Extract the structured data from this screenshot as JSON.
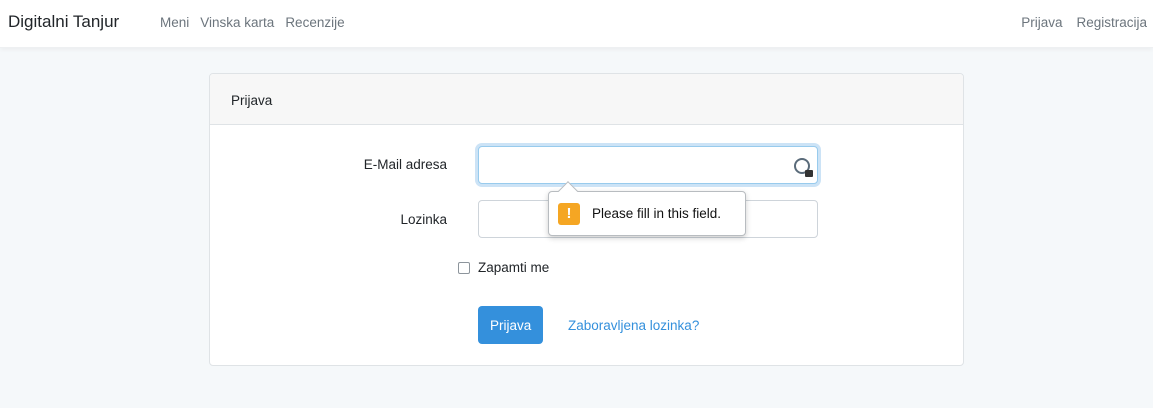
{
  "navbar": {
    "brand": "Digitalni Tanjur",
    "left_links": [
      "Meni",
      "Vinska karta",
      "Recenzije"
    ],
    "right_links": [
      "Prijava",
      "Registracija"
    ]
  },
  "login_card": {
    "header": "Prijava",
    "email_label": "E-Mail adresa",
    "email_value": "",
    "password_label": "Lozinka",
    "password_value": "",
    "remember_label": "Zapamti me",
    "remember_checked": false,
    "submit_label": "Prijava",
    "forgot_label": "Zaboravljena lozinka?"
  },
  "validation_tooltip": {
    "icon": "warning-icon",
    "icon_glyph": "!",
    "message": "Please fill in this field."
  },
  "colors": {
    "primary": "#3490dc",
    "warning": "#f5a623",
    "page_background": "#f5f8fa"
  }
}
